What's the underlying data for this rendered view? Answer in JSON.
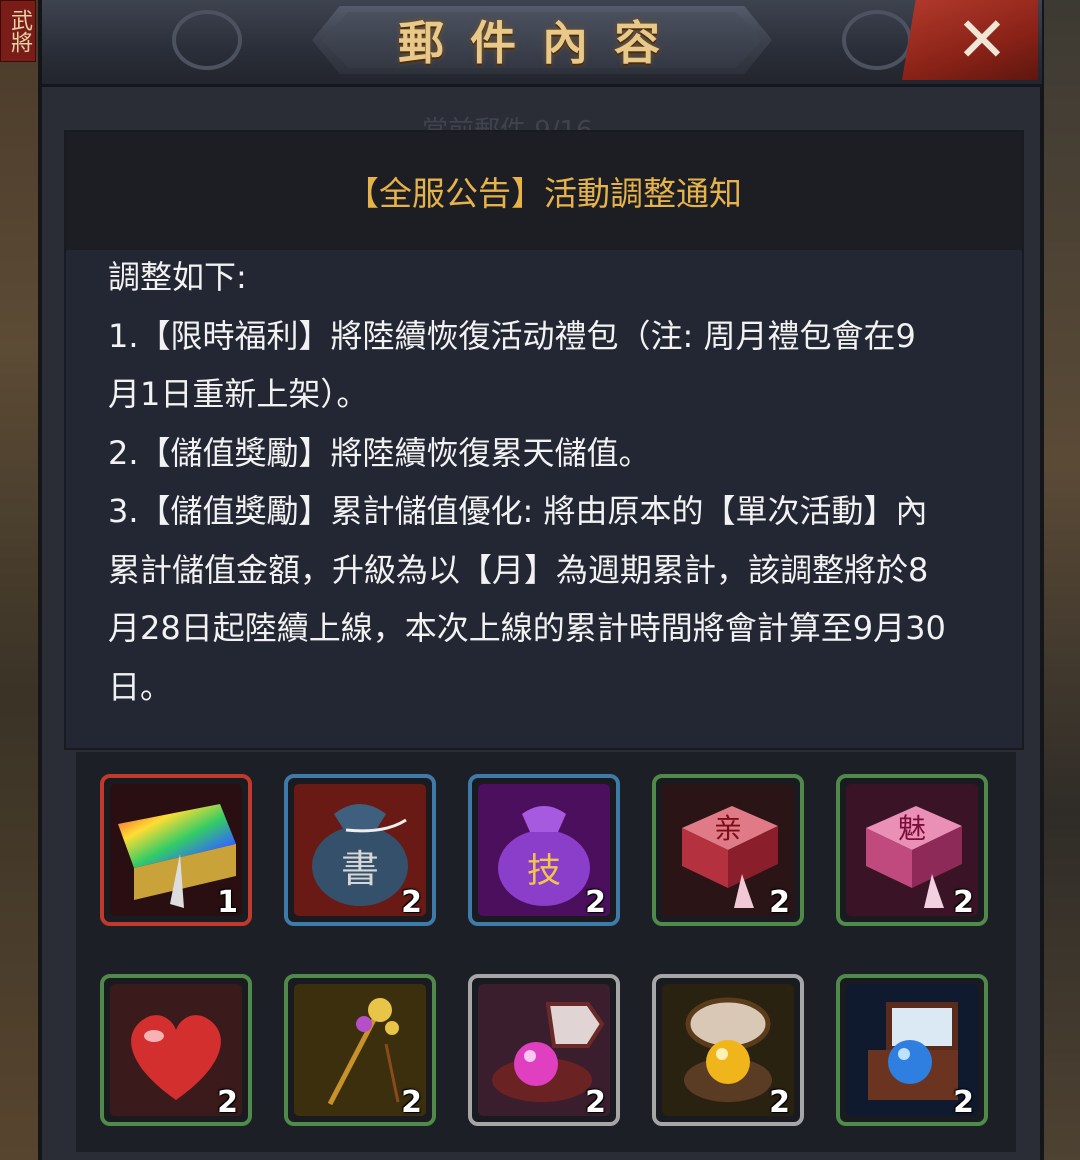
{
  "side_tag": "武將",
  "window": {
    "title": "郵件內容",
    "faded_header": "當前郵件  9/16",
    "close_icon": "close-icon"
  },
  "mail": {
    "subject": "【全服公告】活動調整通知",
    "lines": [
      "調整如下:",
      "1.【限時福利】將陸續恢復活动禮包（注: 周月禮包會在9",
      "月1日重新上架）。",
      "2.【儲值獎勵】將陸續恢復累天儲值。",
      "3.【儲值獎勵】累計儲值優化: 將由原本的【單次活動】內",
      "累計儲值金額，升級為以【月】為週期累計，該調整將於8",
      "月28日起陸續上線，本次上線的累計時間將會計算至9月30",
      "日。"
    ]
  },
  "rewards": [
    {
      "icon": "rainbow-gift-box-icon",
      "count": "1",
      "rarity": "red"
    },
    {
      "icon": "book-pouch-icon",
      "count": "2",
      "rarity": "blue",
      "glyph": "書"
    },
    {
      "icon": "skill-pouch-icon",
      "count": "2",
      "rarity": "blue",
      "glyph": "技"
    },
    {
      "icon": "intimacy-box-icon",
      "count": "2",
      "rarity": "green",
      "glyph": "亲"
    },
    {
      "icon": "charm-box-icon",
      "count": "2",
      "rarity": "green",
      "glyph": "魅"
    },
    {
      "icon": "red-heart-icon",
      "count": "2",
      "rarity": "green"
    },
    {
      "icon": "hairpin-icon",
      "count": "2",
      "rarity": "green"
    },
    {
      "icon": "pink-pearl-case-icon",
      "count": "2",
      "rarity": "gray"
    },
    {
      "icon": "gold-pearl-case-icon",
      "count": "2",
      "rarity": "gray"
    },
    {
      "icon": "blue-pearl-chest-icon",
      "count": "2",
      "rarity": "green"
    }
  ],
  "colors": {
    "title_gold": "#e9c98a",
    "subject_gold": "#e6b24a",
    "close_red": "#b23a2c",
    "panel_bg": "#2a2d35"
  }
}
